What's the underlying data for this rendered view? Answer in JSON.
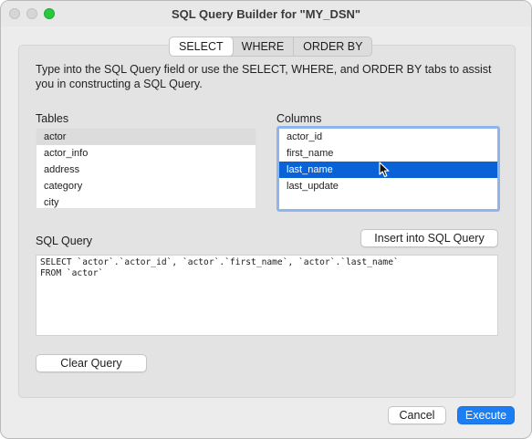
{
  "window": {
    "title": "SQL Query Builder for \"MY_DSN\""
  },
  "tabs": [
    {
      "label": "SELECT",
      "active": true
    },
    {
      "label": "WHERE",
      "active": false
    },
    {
      "label": "ORDER BY",
      "active": false
    }
  ],
  "description": "Type into the SQL Query field or use the SELECT, WHERE, and ORDER BY tabs to assist you in constructing a SQL Query.",
  "tables": {
    "label": "Tables",
    "items": [
      "actor",
      "actor_info",
      "address",
      "category",
      "city"
    ],
    "selected": "actor"
  },
  "columns": {
    "label": "Columns",
    "items": [
      "actor_id",
      "first_name",
      "last_name",
      "last_update"
    ],
    "selected": "last_name"
  },
  "sql": {
    "label": "SQL Query",
    "insert_button": "Insert into SQL Query",
    "lines": [
      "SELECT `actor`.`actor_id`, `actor`.`first_name`, `actor`.`last_name`",
      "FROM `actor`"
    ],
    "clear_button": "Clear Query"
  },
  "footer": {
    "cancel": "Cancel",
    "execute": "Execute"
  },
  "colors": {
    "accent": "#0a63d6",
    "execute": "#1b7ef4",
    "focus_ring": "#8fb4ee"
  }
}
